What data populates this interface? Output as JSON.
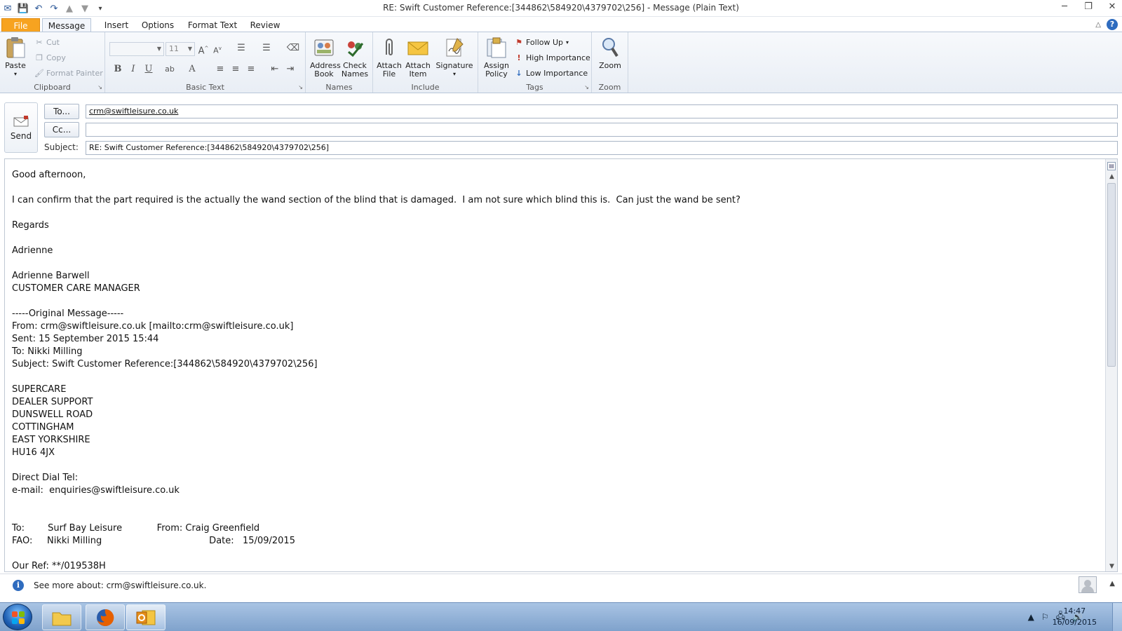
{
  "window": {
    "title": "RE: Swift Customer Reference:[344862\\584920\\4379702\\256]  - Message (Plain Text)"
  },
  "tabs": [
    {
      "label": "File"
    },
    {
      "label": "Message"
    },
    {
      "label": "Insert"
    },
    {
      "label": "Options"
    },
    {
      "label": "Format Text"
    },
    {
      "label": "Review"
    }
  ],
  "ribbon": {
    "clipboard": {
      "label": "Clipboard",
      "paste": "Paste",
      "cut": "Cut",
      "copy": "Copy",
      "format_painter": "Format Painter"
    },
    "basic_text": {
      "label": "Basic Text",
      "font_size": "11"
    },
    "names": {
      "label": "Names",
      "address_book": "Address Book",
      "check_names": "Check Names"
    },
    "include": {
      "label": "Include",
      "attach_file": "Attach File",
      "attach_item": "Attach Item",
      "signature": "Signature"
    },
    "tags": {
      "label": "Tags",
      "assign_policy": "Assign Policy",
      "follow_up": "Follow Up",
      "high_importance": "High Importance",
      "low_importance": "Low Importance"
    },
    "zoom": {
      "label": "Zoom",
      "zoom": "Zoom"
    }
  },
  "compose": {
    "send_label": "Send",
    "to_button": "To...",
    "cc_button": "Cc...",
    "subject_label": "Subject:",
    "to_value": "crm@swiftleisure.co.uk",
    "cc_value": "",
    "subject_value": "RE: Swift Customer Reference:[344862\\584920\\4379702\\256]"
  },
  "body_lines": [
    "Good afternoon,",
    "",
    "I can confirm that the part required is the actually the wand section of the blind that is damaged.  I am not sure which blind this is.  Can just the wand be sent?",
    "",
    "Regards",
    "",
    "Adrienne",
    "",
    "Adrienne Barwell",
    "CUSTOMER CARE MANAGER",
    "",
    "-----Original Message-----",
    "From: crm@swiftleisure.co.uk [mailto:crm@swiftleisure.co.uk]",
    "Sent: 15 September 2015 15:44",
    "To: Nikki Milling",
    "Subject: Swift Customer Reference:[344862\\584920\\4379702\\256]",
    "",
    "SUPERCARE",
    "DEALER SUPPORT",
    "DUNSWELL ROAD",
    "COTTINGHAM",
    "EAST YORKSHIRE",
    "HU16 4JX",
    "",
    "Direct Dial Tel:",
    "e-mail:  enquiries@swiftleisure.co.uk",
    "",
    "",
    "To:        Surf Bay Leisure            From: Craig Greenfield",
    "FAO:     Nikki Milling                                     Date:   15/09/2015",
    "",
    "Our Ref: **/019538H"
  ],
  "people_pane": {
    "text": "See more about: crm@swiftleisure.co.uk."
  },
  "taskbar": {
    "time": "14:47",
    "date": "16/09/2015"
  },
  "colors": {
    "file_tab": "#f7a320",
    "accent_blue": "#2f6cbf"
  }
}
